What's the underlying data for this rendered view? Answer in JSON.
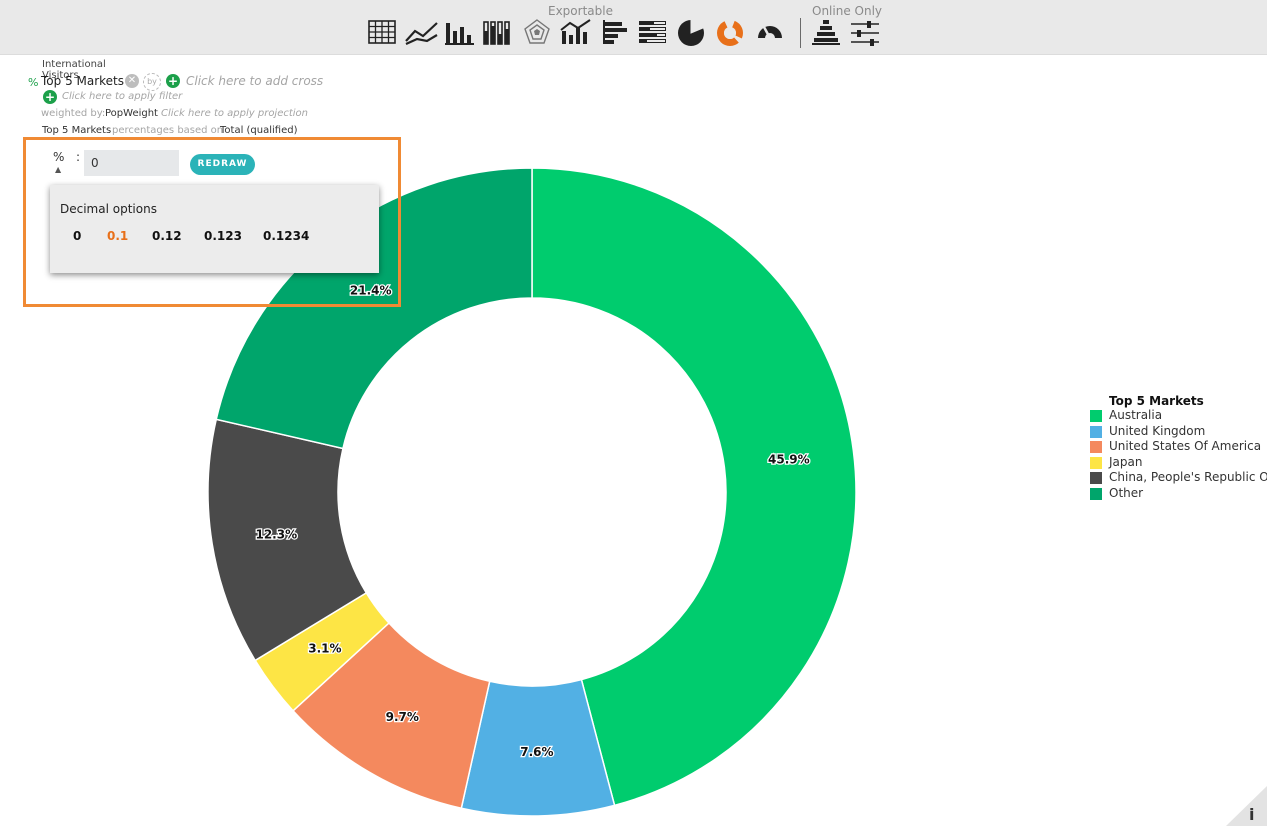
{
  "toolbar": {
    "exportable_label": "Exportable",
    "online_only_label": "Online Only",
    "icons": [
      "table-icon",
      "line-chart-icon",
      "bar-chart-icon",
      "column-stack-icon",
      "radar-chart-icon",
      "combo-chart-icon",
      "horizontal-bar-icon",
      "stacked-bar-icon",
      "pie-chart-icon",
      "donut-chart-icon",
      "gauge-chart-icon",
      "pyramid-chart-icon",
      "slider-settings-icon"
    ],
    "active_icon": "donut-chart-icon",
    "active_color": "#e8701a"
  },
  "report": {
    "dataset": "International Visitors",
    "measure_symbol": "%",
    "variable": "Top 5 Markets",
    "by_label": "by",
    "add_cross_placeholder": "Click here to add cross",
    "filter_placeholder": "Click here to apply filter",
    "weighted_prefix": "weighted by:",
    "weight_name": "PopWeight",
    "projection_placeholder": "Click here to apply projection",
    "base_variable": "Top 5 Markets",
    "base_text": "percentages based on",
    "base_value": "Total (qualified)"
  },
  "decimal_control": {
    "symbol": "%",
    "separator": ":",
    "value": "0",
    "redraw_label": "REDRAW",
    "popup_title": "Decimal options",
    "options": [
      "0",
      "0.1",
      "0.12",
      "0.123",
      "0.1234"
    ],
    "selected_option": "0.1",
    "highlight_color": "#f08a34"
  },
  "chart_data": {
    "type": "pie",
    "donut": true,
    "title": "",
    "legend_title": "Top 5 Markets",
    "legend_position": "right",
    "categories": [
      "Australia",
      "United Kingdom",
      "United States Of America",
      "Japan",
      "China, People's Republic Of",
      "Other"
    ],
    "values": [
      45.9,
      7.6,
      9.7,
      3.1,
      12.3,
      21.4
    ],
    "labels": [
      "45.9%",
      "7.6%",
      "9.7%",
      "3.1%",
      "12.3%",
      "21.4%"
    ],
    "colors": [
      "#00cc6e",
      "#52b0e4",
      "#f4895e",
      "#fde545",
      "#4a4a4a",
      "#00a56b"
    ]
  },
  "corner": {
    "info_label": "i"
  }
}
